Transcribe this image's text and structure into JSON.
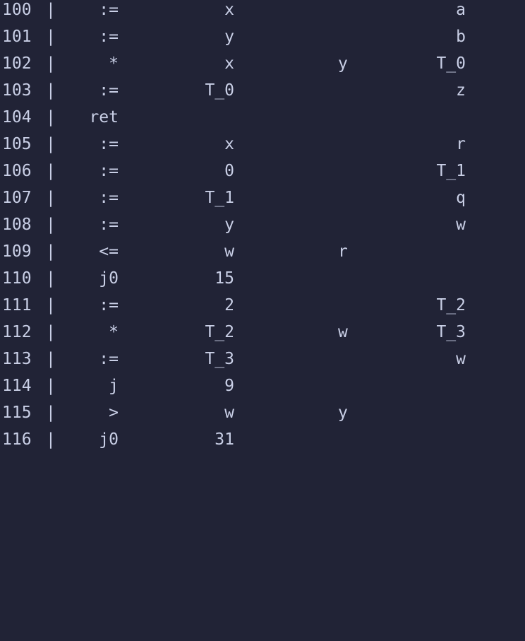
{
  "separator": "|",
  "rows": [
    {
      "num": "100",
      "op": ":=",
      "arg1": "x",
      "arg2": "",
      "result": "a"
    },
    {
      "num": "101",
      "op": ":=",
      "arg1": "y",
      "arg2": "",
      "result": "b"
    },
    {
      "num": "102",
      "op": "*",
      "arg1": "x",
      "arg2": "y",
      "result": "T_0"
    },
    {
      "num": "103",
      "op": ":=",
      "arg1": "T_0",
      "arg2": "",
      "result": "z"
    },
    {
      "num": "104",
      "op": "ret",
      "arg1": "",
      "arg2": "",
      "result": ""
    },
    {
      "num": "105",
      "op": ":=",
      "arg1": "x",
      "arg2": "",
      "result": "r"
    },
    {
      "num": "106",
      "op": ":=",
      "arg1": "0",
      "arg2": "",
      "result": "T_1"
    },
    {
      "num": "107",
      "op": ":=",
      "arg1": "T_1",
      "arg2": "",
      "result": "q"
    },
    {
      "num": "108",
      "op": ":=",
      "arg1": "y",
      "arg2": "",
      "result": "w"
    },
    {
      "num": "109",
      "op": "<=",
      "arg1": "w",
      "arg2": "r",
      "result": ""
    },
    {
      "num": "110",
      "op": "j0",
      "arg1": "15",
      "arg2": "",
      "result": ""
    },
    {
      "num": "111",
      "op": ":=",
      "arg1": "2",
      "arg2": "",
      "result": "T_2"
    },
    {
      "num": "112",
      "op": "*",
      "arg1": "T_2",
      "arg2": "w",
      "result": "T_3"
    },
    {
      "num": "113",
      "op": ":=",
      "arg1": "T_3",
      "arg2": "",
      "result": "w"
    },
    {
      "num": "114",
      "op": "j",
      "arg1": "9",
      "arg2": "",
      "result": ""
    },
    {
      "num": "115",
      "op": ">",
      "arg1": "w",
      "arg2": "y",
      "result": ""
    },
    {
      "num": "116",
      "op": "j0",
      "arg1": "31",
      "arg2": "",
      "result": ""
    }
  ]
}
